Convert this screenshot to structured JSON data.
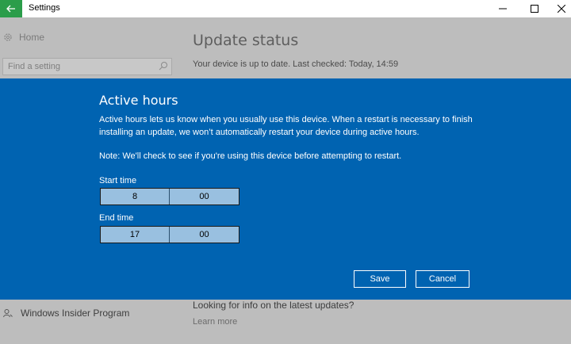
{
  "window": {
    "title": "Settings",
    "back_icon": "arrow-left-icon",
    "controls": [
      "minimize-icon",
      "maximize-icon",
      "close-icon"
    ]
  },
  "sidebar": {
    "home_label": "Home",
    "search_placeholder": "Find a setting",
    "insider_label": "Windows Insider Program"
  },
  "main": {
    "title": "Update status",
    "status": "Your device is up to date. Last checked: Today, 14:59",
    "looking_text": "Looking for info on the latest updates?",
    "learn_more": "Learn more"
  },
  "dialog": {
    "title": "Active hours",
    "description": "Active hours lets us know when you usually use this device. When a restart is necessary to finish installing an update, we won’t automatically restart your device during active hours.",
    "note": "Note: We'll check to see if you're using this device before attempting to restart.",
    "start_label": "Start time",
    "start_hour": "8",
    "start_minute": "00",
    "end_label": "End time",
    "end_hour": "17",
    "end_minute": "00",
    "save_label": "Save",
    "cancel_label": "Cancel"
  },
  "colors": {
    "dialog_bg": "#0063b1",
    "back_button": "#2b9d4a",
    "picker_bg": "#99c0e0"
  }
}
